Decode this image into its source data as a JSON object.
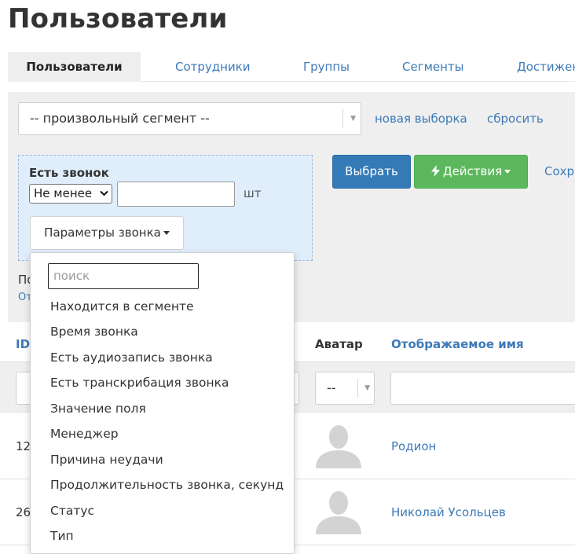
{
  "page": {
    "title": "Пользователи"
  },
  "tabs": [
    {
      "label": "Пользователи",
      "active": true
    },
    {
      "label": "Сотрудники"
    },
    {
      "label": "Группы"
    },
    {
      "label": "Сегменты"
    },
    {
      "label": "Достижен"
    }
  ],
  "segment_select": {
    "value": "-- произвольный сегмент --"
  },
  "links": {
    "new_selection": "новая выборка",
    "reset": "сбросить"
  },
  "condition": {
    "title": "Есть звонок",
    "operator": "Не менее",
    "count_value": "",
    "unit": "шт",
    "params_button": "Параметры звонка"
  },
  "buttons": {
    "select": "Выбрать",
    "actions": "Действия",
    "save_partial": "Сохр"
  },
  "partial_left": {
    "line1": "По",
    "line2": "От"
  },
  "dropdown": {
    "search_placeholder": "поиск",
    "items": [
      "Находится в сегменте",
      "Время звонка",
      "Есть аудиозапись звонка",
      "Есть транскрибация звонка",
      "Значение поля",
      "Менеджер",
      "Причина неудачи",
      "Продолжительность звонка, секунд",
      "Статус",
      "Тип"
    ]
  },
  "table": {
    "columns": {
      "id": "ID",
      "avatar": "Аватар",
      "display_name": "Отображаемое имя"
    },
    "avatar_filter": "--",
    "rows": [
      {
        "id_partial": "12",
        "name": "Родион"
      },
      {
        "id_partial": "26",
        "name": "Николай Усольцев"
      }
    ]
  },
  "colors": {
    "accent_link": "#3d7ab8",
    "primary_button": "#337ab7",
    "success_button": "#5cb85c",
    "condition_bg": "#e0edfb"
  }
}
